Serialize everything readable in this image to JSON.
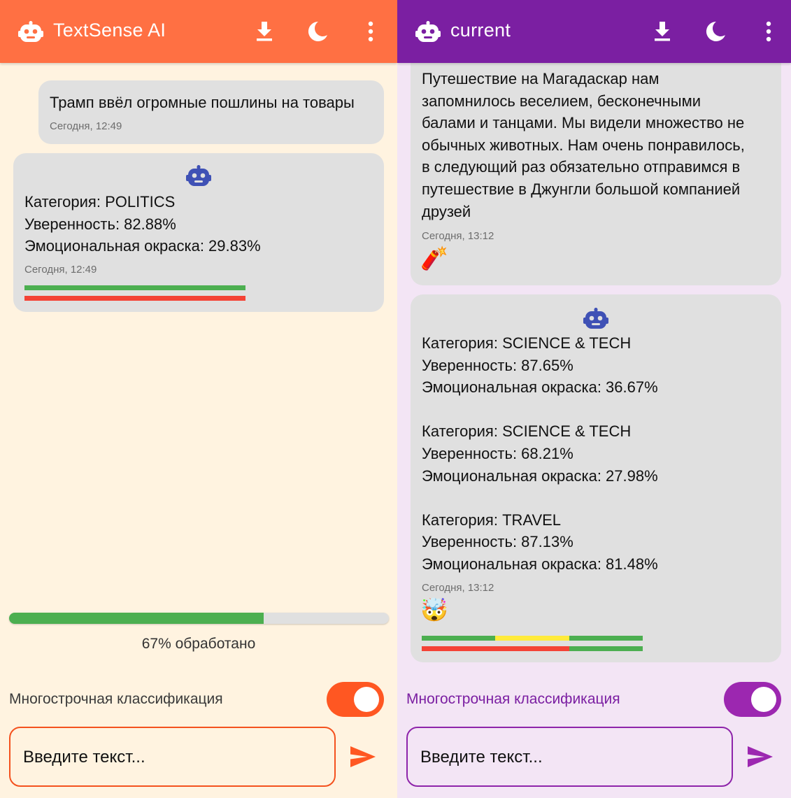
{
  "left": {
    "app_title": "TextSense AI",
    "user_message": {
      "text": "Трамп ввёл огромные пошлины на товары",
      "time": "Сегодня, 12:49"
    },
    "bot_message": {
      "lines": [
        "Категория: POLITICS",
        "Уверенность: 82.88%",
        "Эмоциональная окраска: 29.83%"
      ],
      "time": "Сегодня, 12:49"
    },
    "progress": {
      "fraction": 0.67,
      "label": "67% обработано"
    },
    "multiline_label": "Многострочная классификация",
    "multiline_on": true,
    "input_placeholder": "Введите текст...",
    "colors": {
      "primary": "#ff7043",
      "accent": "#f4511e",
      "background": "#fff3e0"
    }
  },
  "right": {
    "app_title": "current",
    "user_message": {
      "lines": [
        "Путешествие на Магадаскар нам",
        "запомнилось веселием, бесконечными",
        "балами и танцами. Мы видели множество не",
        "обычных животных. Нам очень понравилось,",
        "в следующий раз обязательно отправимся в",
        "путешествие в Джунгли большой компанией",
        "друзей"
      ],
      "time": "Сегодня, 13:12",
      "emoji": "🧨"
    },
    "bot_message": {
      "blocks": [
        [
          "Категория: SCIENCE & TECH",
          "Уверенность: 87.65%",
          "Эмоциональная окраска: 36.67%"
        ],
        [
          "Категория: SCIENCE & TECH",
          "Уверенность: 68.21%",
          "Эмоциональная окраска: 27.98%"
        ],
        [
          "Категория: TRAVEL",
          "Уверенность: 87.13%",
          "Эмоциональная окраска: 81.48%"
        ]
      ],
      "time": "Сегодня, 13:12",
      "emoji": "🤯"
    },
    "multiline_label": "Многострочная классификация",
    "multiline_on": true,
    "input_placeholder": "Введите текст...",
    "colors": {
      "primary": "#7b1fa2",
      "accent": "#8e24aa",
      "background": "#f3e5f5"
    }
  },
  "icons": {
    "logo": "robot-icon",
    "download": "download-icon",
    "theme": "dark-mode-moon-icon",
    "menu": "more-vert-icon",
    "send": "send-icon"
  }
}
